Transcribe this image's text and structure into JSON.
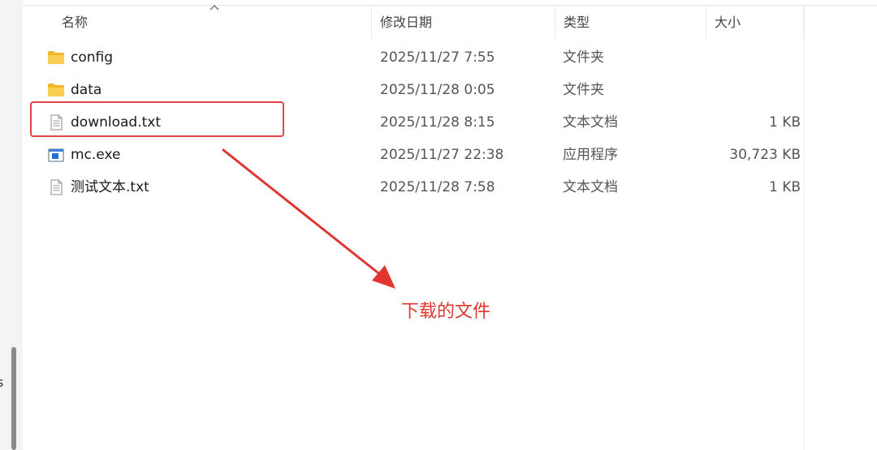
{
  "columns": {
    "name": "名称",
    "modified": "修改日期",
    "type": "类型",
    "size": "大小"
  },
  "files": [
    {
      "name": "config",
      "modified": "2025/11/27 7:55",
      "type": "文件夹",
      "size": "",
      "icon": "folder-icon"
    },
    {
      "name": "data",
      "modified": "2025/11/28 0:05",
      "type": "文件夹",
      "size": "",
      "icon": "folder-icon"
    },
    {
      "name": "download.txt",
      "modified": "2025/11/28 8:15",
      "type": "文本文档",
      "size": "1 KB",
      "icon": "text-file-icon"
    },
    {
      "name": "mc.exe",
      "modified": "2025/11/27 22:38",
      "type": "应用程序",
      "size": "30,723 KB",
      "icon": "exe-file-icon"
    },
    {
      "name": "测试文本.txt",
      "modified": "2025/11/28 7:58",
      "type": "文本文档",
      "size": "1 KB",
      "icon": "text-file-icon"
    }
  ],
  "annotation": {
    "label": "下载的文件",
    "color": "#e0362f"
  },
  "colors": {
    "folder": "#f5c342",
    "highlight": "#e24545"
  },
  "sidebar_fragment": "s"
}
